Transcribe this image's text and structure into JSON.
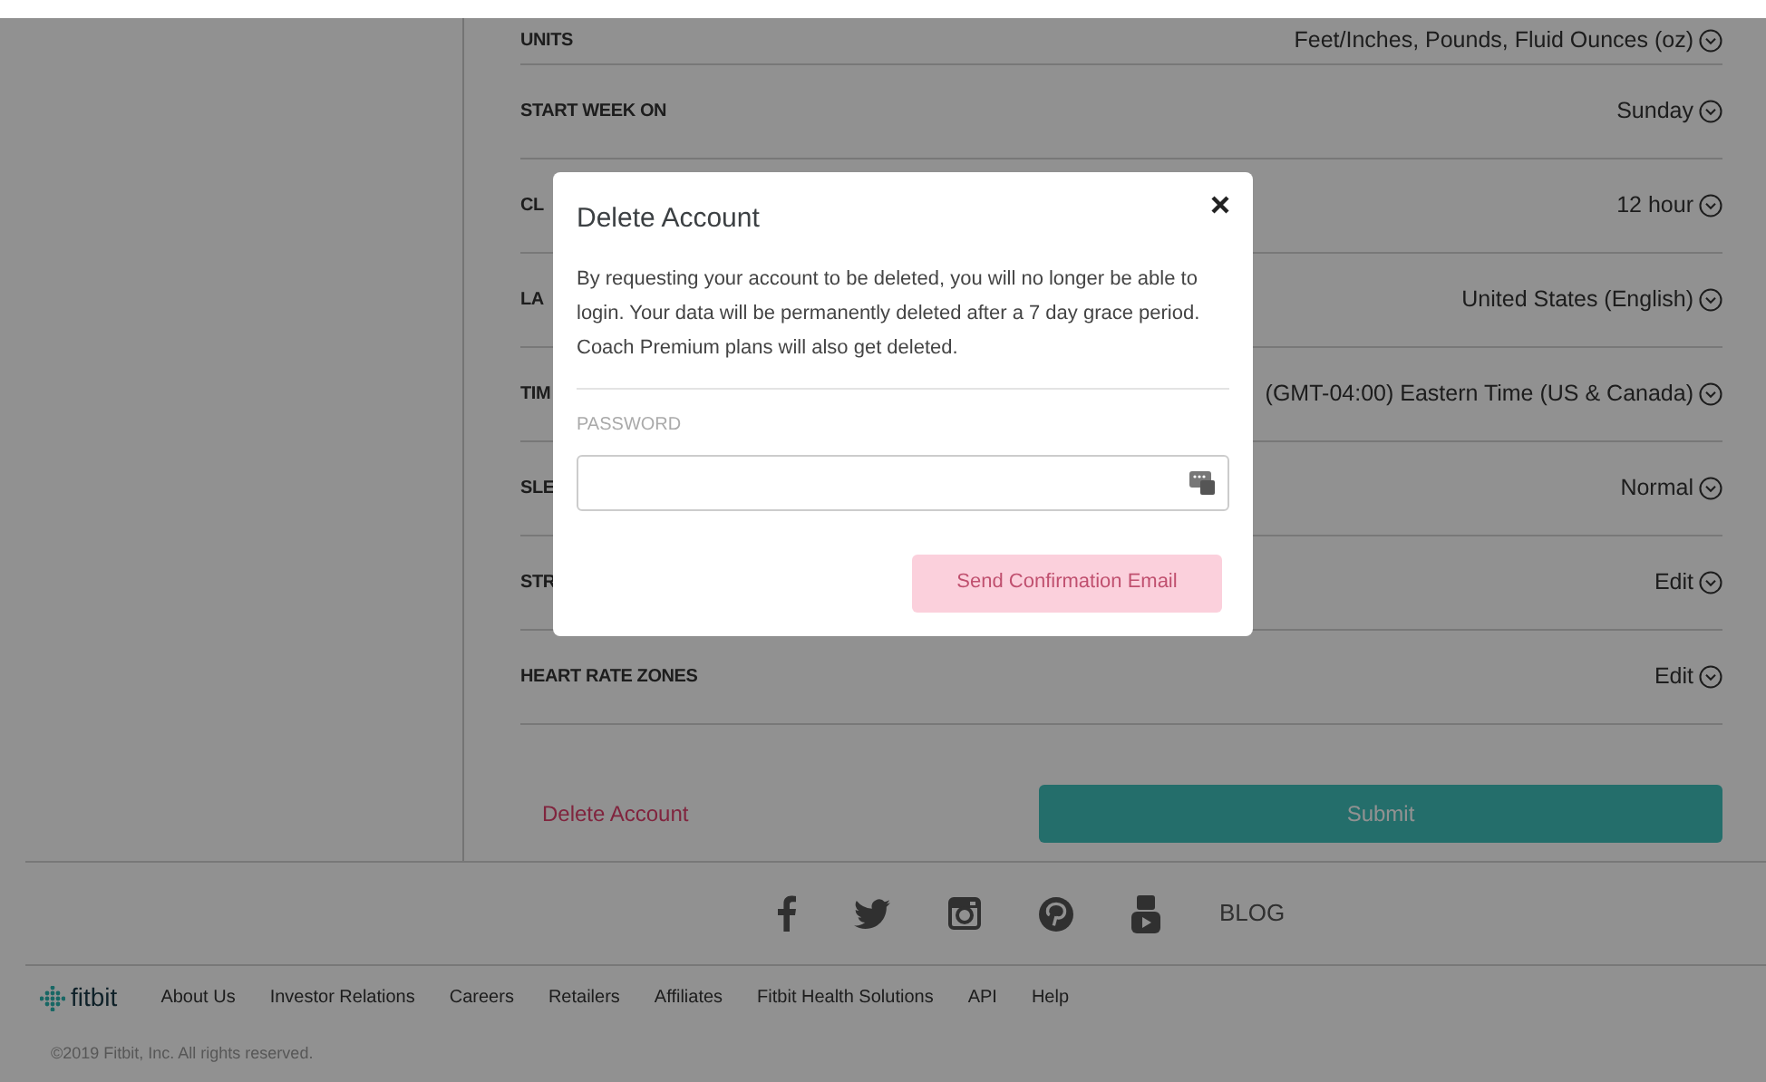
{
  "settings": [
    {
      "label": "UNITS",
      "value": "Feet/Inches, Pounds, Fluid Ounces (oz)"
    },
    {
      "label": "START WEEK ON",
      "value": "Sunday"
    },
    {
      "label": "CL",
      "value": "12 hour"
    },
    {
      "label": "LA",
      "value": "United States (English)"
    },
    {
      "label": "TIM",
      "value": "(GMT-04:00) Eastern Time (US & Canada)"
    },
    {
      "label": "SLE",
      "value": "Normal"
    },
    {
      "label": "STR",
      "value": "Edit"
    },
    {
      "label": "HEART RATE ZONES",
      "value": "Edit"
    }
  ],
  "delete_link": "Delete Account",
  "submit_button": "Submit",
  "social": {
    "blog": "BLOG"
  },
  "footer": {
    "logo": "fitbit",
    "links": [
      "About Us",
      "Investor Relations",
      "Careers",
      "Retailers",
      "Affiliates",
      "Fitbit Health Solutions",
      "API",
      "Help"
    ],
    "copyright": "©2019 Fitbit, Inc. All rights reserved."
  },
  "modal": {
    "title": "Delete Account",
    "message": "By requesting your account to be deleted, you will no longer be able to login. Your data will be permanently deleted after a 7 day grace period. Coach Premium plans will also get deleted.",
    "password_label": "PASSWORD",
    "button": {
      "label": "Send Confirmation Email",
      "disabled": true
    }
  }
}
